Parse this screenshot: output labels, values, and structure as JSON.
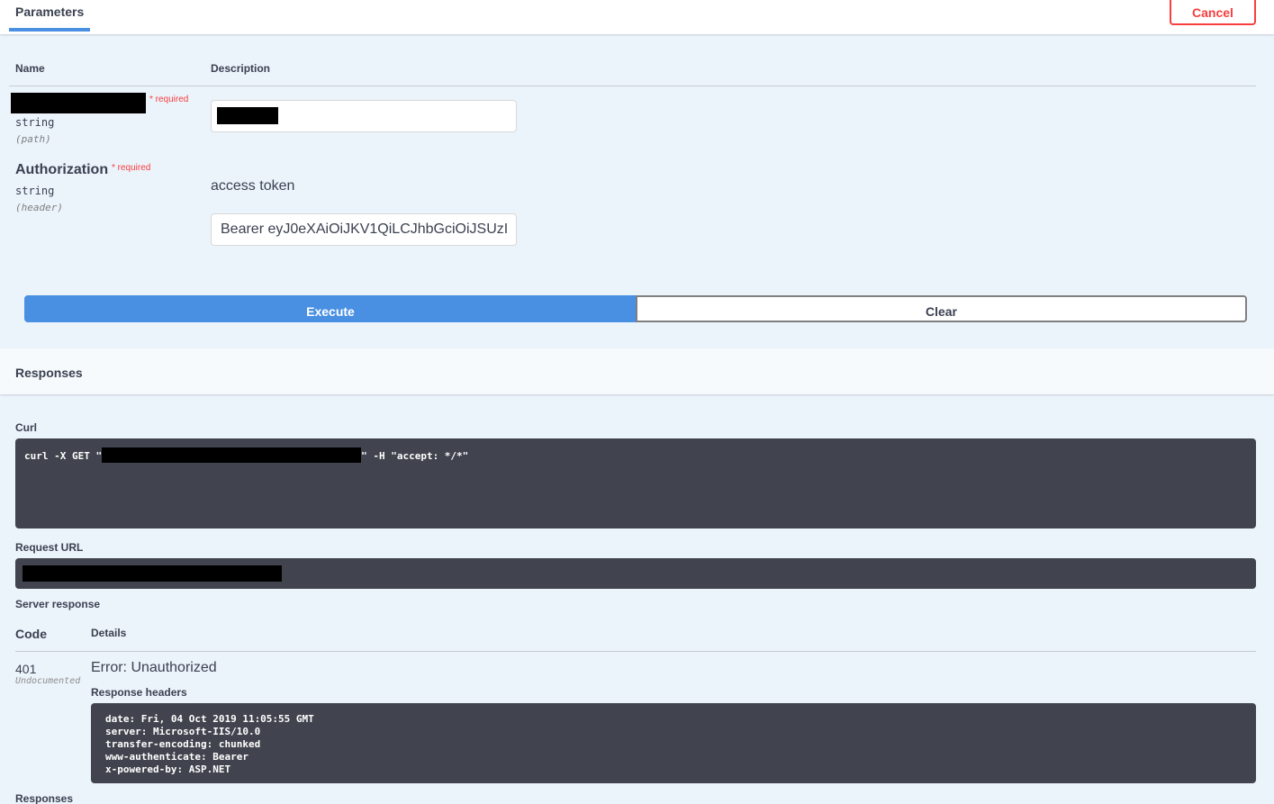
{
  "header": {
    "tab_label": "Parameters",
    "cancel_label": "Cancel"
  },
  "params": {
    "col_name": "Name",
    "col_description": "Description",
    "param1": {
      "required": "* required",
      "type": "string",
      "location": "(path)"
    },
    "param2": {
      "name": "Authorization",
      "required": "* required",
      "type": "string",
      "location": "(header)",
      "description": "access token",
      "value": "Bearer eyJ0eXAiOiJKV1QiLCJhbGciOiJSUzI"
    }
  },
  "actions": {
    "execute_label": "Execute",
    "clear_label": "Clear"
  },
  "responses": {
    "title": "Responses",
    "curl_label": "Curl",
    "curl_prefix": "curl -X GET \"",
    "curl_suffix": "\" -H \"accept: */*\"",
    "request_url_label": "Request URL",
    "server_response_label": "Server response",
    "col_code": "Code",
    "col_details": "Details",
    "code": "401",
    "code_note": "Undocumented",
    "error_text": "Error: Unauthorized",
    "response_headers_label": "Response headers",
    "headers": [
      "date: Fri, 04 Oct 2019 11:05:55 GMT",
      "server: Microsoft-IIS/10.0",
      "transfer-encoding: chunked",
      "www-authenticate: Bearer",
      "x-powered-by: ASP.NET"
    ],
    "bottom_label": "Responses"
  },
  "colors": {
    "accent": "#4990e2",
    "danger": "#f93e3e",
    "code_bg": "#41444e",
    "page_bg": "#ebf3fb"
  }
}
